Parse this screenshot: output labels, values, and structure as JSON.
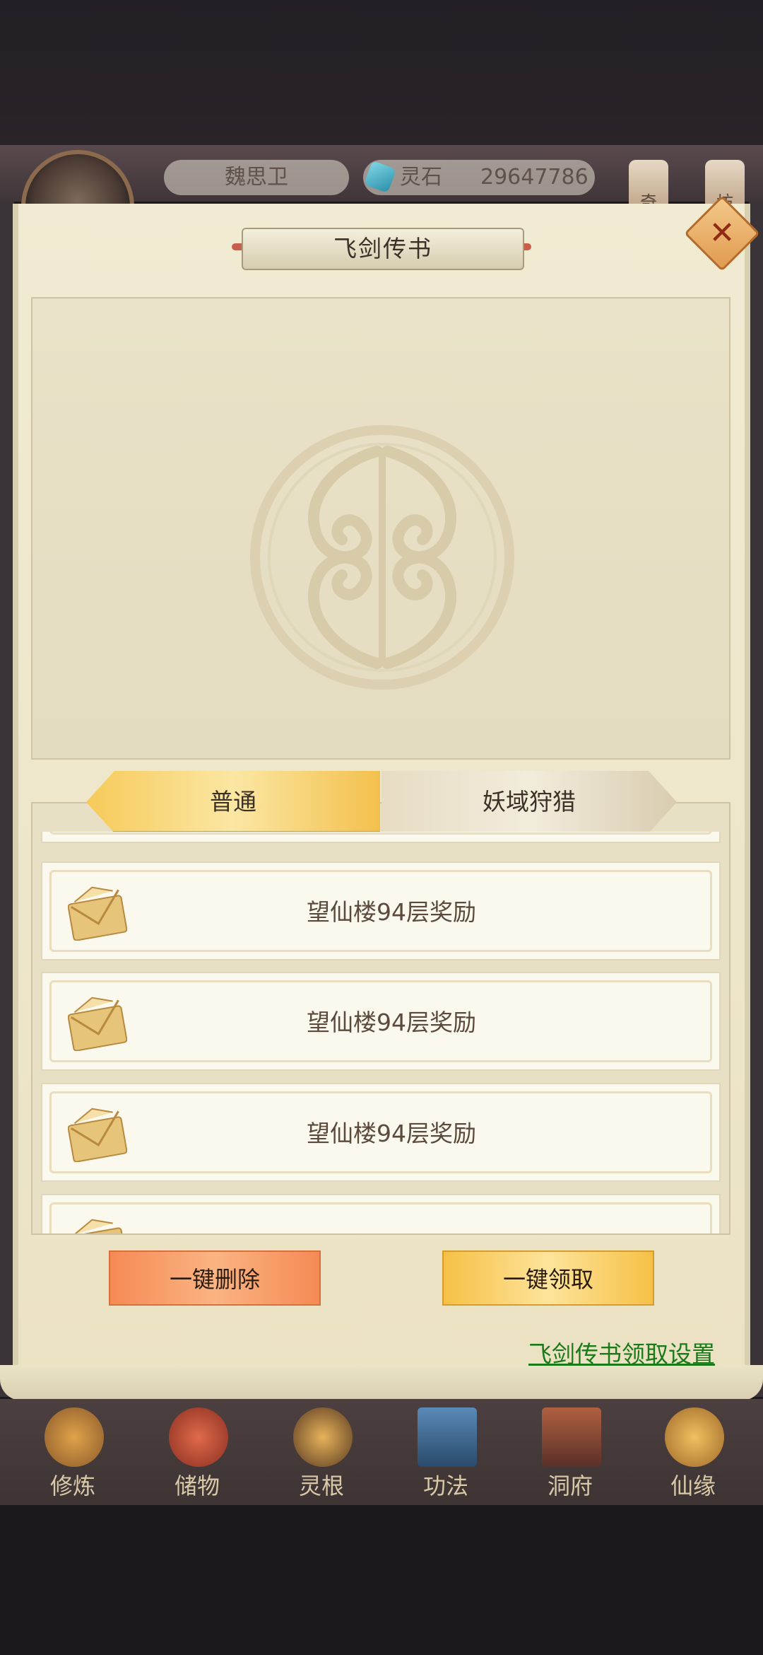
{
  "hud": {
    "player_name": "魏思卫",
    "resource_label": "灵石",
    "resource_value": "29647786",
    "side_buttons": [
      "奇",
      "坊"
    ]
  },
  "dialog": {
    "title": "飞剑传书",
    "tabs": [
      {
        "label": "普通",
        "active": true
      },
      {
        "label": "妖域狩猎",
        "active": false
      }
    ],
    "mails": [
      {
        "title": "望仙楼94层奖励"
      },
      {
        "title": "望仙楼94层奖励"
      },
      {
        "title": "望仙楼94层奖励"
      }
    ],
    "delete_all_label": "一键删除",
    "claim_all_label": "一键领取",
    "settings_link": "飞剑传书领取设置"
  },
  "bottom_nav": [
    {
      "label": "修炼",
      "icon": "cultivate-icon"
    },
    {
      "label": "储物",
      "icon": "storage-bag-icon"
    },
    {
      "label": "灵根",
      "icon": "spirit-root-icon"
    },
    {
      "label": "功法",
      "icon": "technique-book-icon"
    },
    {
      "label": "洞府",
      "icon": "cave-dwelling-icon"
    },
    {
      "label": "仙缘",
      "icon": "immortal-fate-icon"
    }
  ],
  "colors": {
    "accent_gold": "#f6c046",
    "accent_orange": "#f58a55",
    "link_green": "#1a7a1a",
    "panel_bg": "#eee6ca"
  }
}
